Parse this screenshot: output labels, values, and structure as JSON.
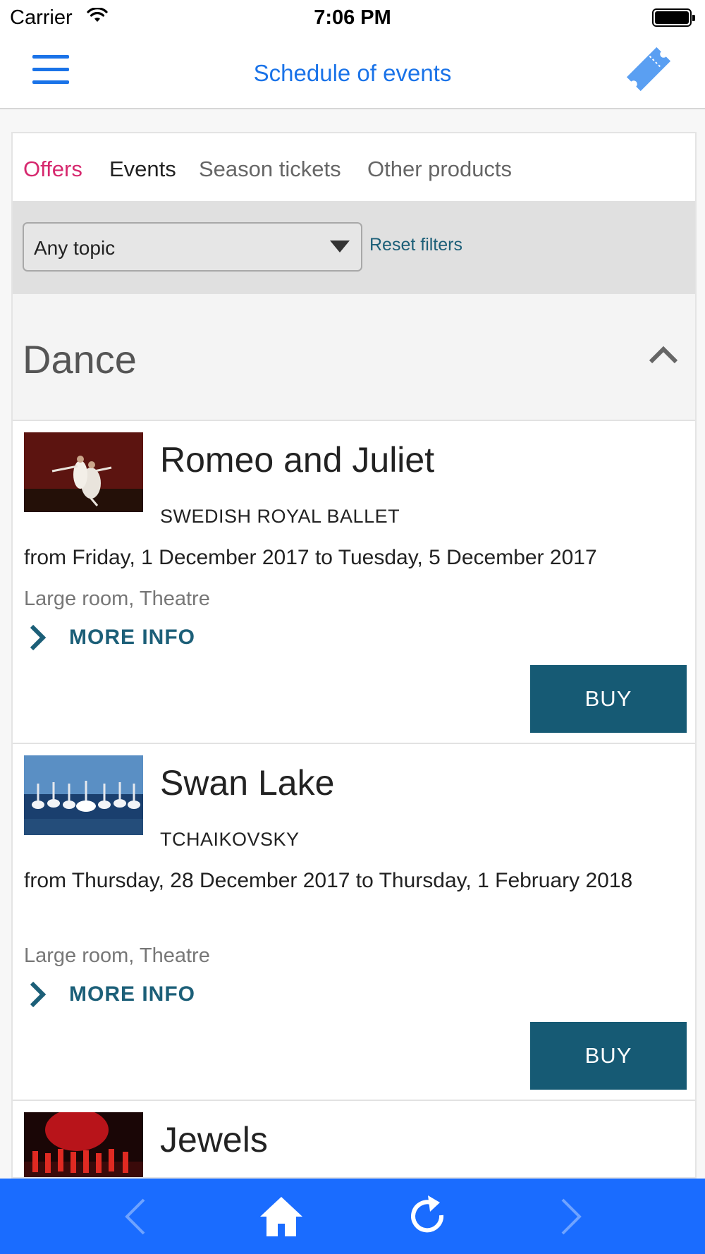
{
  "status_bar": {
    "carrier": "Carrier",
    "time": "7:06 PM"
  },
  "nav": {
    "title": "Schedule of events",
    "menu_icon": "hamburger-menu-icon",
    "ticket_icon": "ticket-icon",
    "accent_color": "#1a73e8"
  },
  "tabs": [
    {
      "label": "Offers",
      "active": true,
      "color": "#d6286e"
    },
    {
      "label": "Events"
    },
    {
      "label": "Season tickets"
    },
    {
      "label": "Other products"
    }
  ],
  "filters": {
    "topic_selected": "Any topic",
    "reset_label": "Reset filters"
  },
  "section": {
    "title": "Dance",
    "collapse_icon": "chevron-up-icon"
  },
  "events": [
    {
      "title": "Romeo and Juliet",
      "subtitle": "SWEDISH ROYAL BALLET",
      "dates": "from Friday, 1 December 2017 to Tuesday, 5 December 2017",
      "venue": "Large room, Theatre",
      "more_label": "MORE INFO",
      "buy_label": "BUY"
    },
    {
      "title": "Swan Lake",
      "subtitle": "TCHAIKOVSKY",
      "dates": "from Thursday, 28 December 2017 to Thursday, 1 February 2018",
      "venue": "Large room, Theatre",
      "more_label": "MORE INFO",
      "buy_label": "BUY"
    },
    {
      "title": "Jewels"
    }
  ],
  "toolbar": {
    "back_icon": "back-arrow-icon",
    "home_icon": "home-icon",
    "reload_icon": "reload-icon",
    "forward_icon": "forward-arrow-icon",
    "background": "#1a6cff",
    "button_color": "#165a74"
  }
}
